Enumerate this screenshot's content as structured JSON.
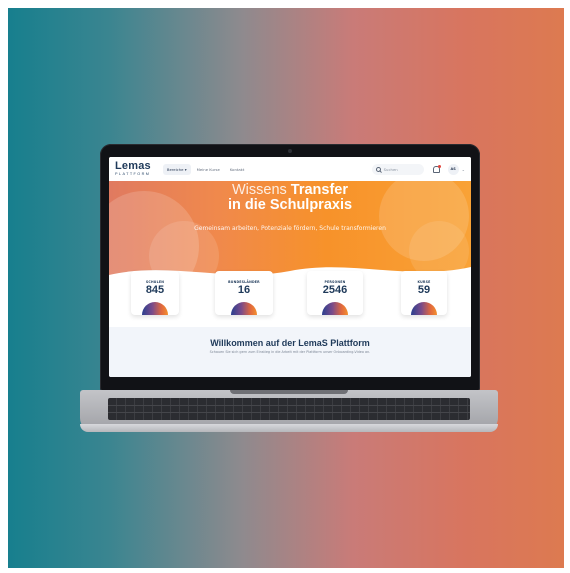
{
  "header": {
    "logo_main": "Lemas",
    "logo_sub": "PLATTFORM",
    "nav": [
      {
        "label": "Bereiche ▾"
      },
      {
        "label": "Meine Kurse"
      },
      {
        "label": "Kontakt"
      }
    ],
    "search_placeholder": "Suchen",
    "avatar_initials": "AS",
    "chevron": "⌄"
  },
  "hero": {
    "title_light": "Wissens",
    "title_bold": "Transfer",
    "title_line2": "in die Schulpraxis",
    "subtitle": "Gemeinsam arbeiten, Potenziale fördern, Schule transformieren"
  },
  "stats": [
    {
      "label": "SCHULEN",
      "value": "845"
    },
    {
      "label": "BUNDESLÄNDER",
      "value": "16"
    },
    {
      "label": "PERSONEN",
      "value": "2546"
    },
    {
      "label": "KURSE",
      "value": "59"
    }
  ],
  "welcome": {
    "title": "Willkommen auf der LemaS Plattform",
    "subtitle": "Schauen Sie sich gern zum Einstieg in die Arbeit mit der Plattform unser Onboarding-Video an."
  },
  "colors": {
    "brand_navy": "#1f3a5a",
    "hero_orange": "#f7922a",
    "notification_dot": "#e2443c"
  }
}
